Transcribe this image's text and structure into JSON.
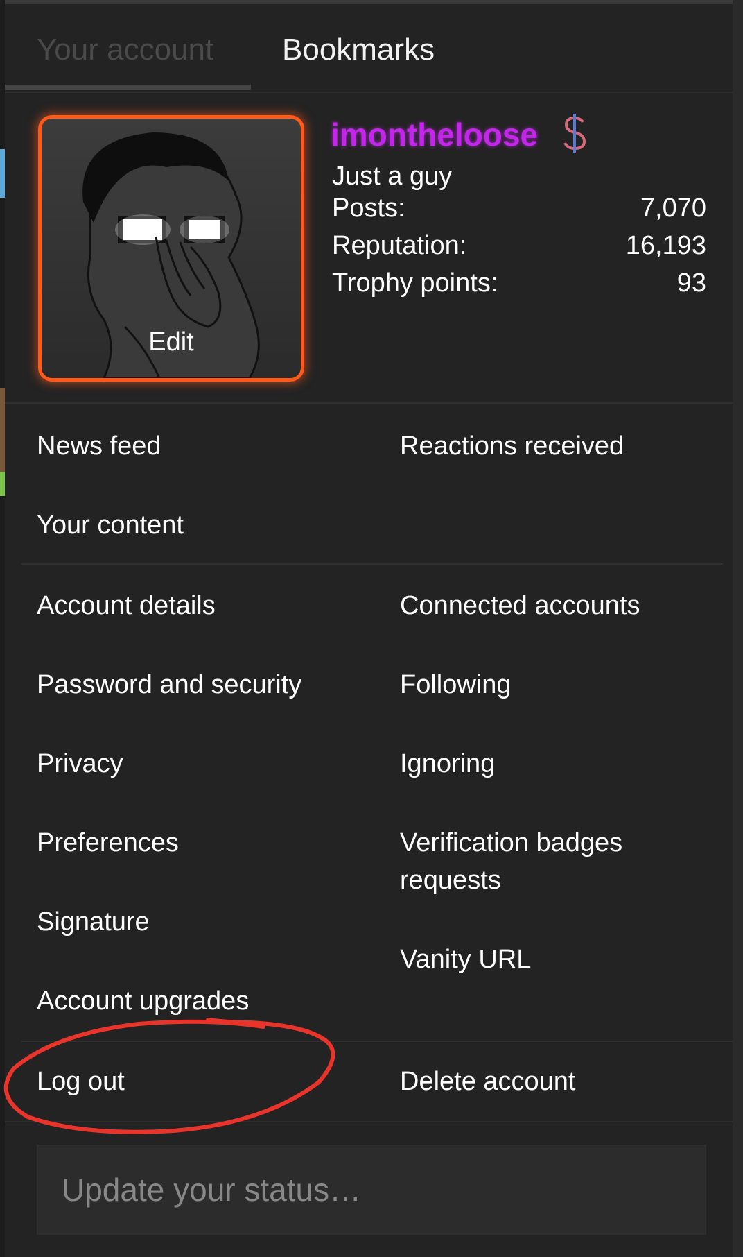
{
  "tabs": {
    "account": "Your account",
    "bookmarks": "Bookmarks"
  },
  "profile": {
    "avatar_edit": "Edit",
    "username": "imontheloose",
    "username_color": "#c226e8",
    "avatar_border_color": "#ff5a1a",
    "badge_icon": "dollar-icon",
    "title": "Just a guy",
    "stats": [
      {
        "label": "Posts:",
        "value": "7,070"
      },
      {
        "label": "Reputation:",
        "value": "16,193"
      },
      {
        "label": "Trophy points:",
        "value": "93"
      }
    ]
  },
  "menu": {
    "news_feed": "News feed",
    "reactions_received": "Reactions received",
    "your_content": "Your content",
    "account_details": "Account details",
    "connected_accounts": "Connected accounts",
    "password_security": "Password and security",
    "following": "Following",
    "privacy": "Privacy",
    "ignoring": "Ignoring",
    "preferences": "Preferences",
    "verification_line1": "Verification badges",
    "verification_line2": "requests",
    "signature": "Signature",
    "vanity_url": "Vanity URL",
    "account_upgrades": "Account upgrades",
    "log_out": "Log out",
    "delete_account": "Delete account"
  },
  "status": {
    "placeholder": "Update your status…"
  },
  "annotation_color": "#e8342a"
}
